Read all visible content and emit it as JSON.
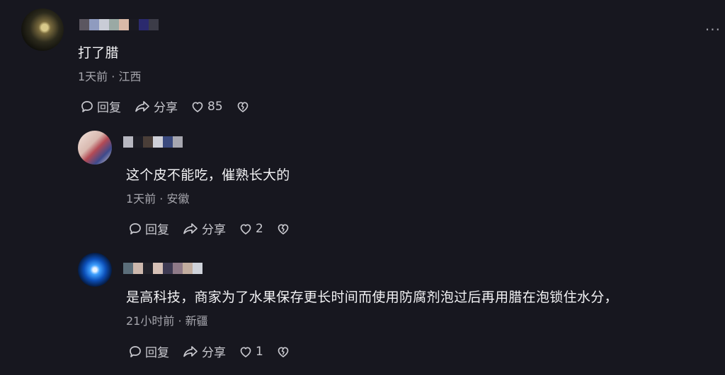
{
  "comments": [
    {
      "text": "打了腊",
      "meta": "1天前 · 江西",
      "actions": {
        "reply": "回复",
        "share": "分享",
        "likes": "85"
      }
    },
    {
      "text": "这个皮不能吃，催熟长大的",
      "meta": "1天前 · 安徽",
      "actions": {
        "reply": "回复",
        "share": "分享",
        "likes": "2"
      }
    },
    {
      "text": "是高科技，商家为了水果保存更长时间而使用防腐剂泡过后再用腊在泡锁住水分，",
      "meta": "21小时前 · 新疆",
      "actions": {
        "reply": "回复",
        "share": "分享",
        "likes": "1"
      }
    }
  ],
  "more_label": "···",
  "icons": {
    "reply": "comment-bubble-icon",
    "share": "share-arrow-icon",
    "like": "heart-icon",
    "dislike": "broken-heart-icon"
  }
}
